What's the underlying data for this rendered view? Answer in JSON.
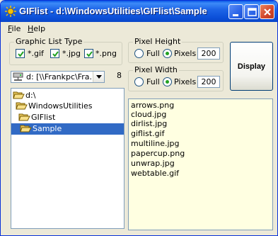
{
  "window": {
    "title": "GIFlist - d:\\WindowsUtilities\\GIFlist\\Sample"
  },
  "menu": [
    {
      "accel": "F",
      "rest": "ile"
    },
    {
      "accel": "H",
      "rest": "elp"
    }
  ],
  "graphic_type": {
    "title": "Graphic List Type",
    "options": [
      {
        "label": "*.gif",
        "checked": true
      },
      {
        "label": "*.jpg",
        "checked": true
      },
      {
        "label": "*.png",
        "checked": true
      }
    ]
  },
  "pixel_height": {
    "title": "Pixel Height",
    "full_label": "Full",
    "pixels_label": "Pixels",
    "selected": "Pixels",
    "value": "200"
  },
  "pixel_width": {
    "title": "Pixel Width",
    "full_label": "Full",
    "pixels_label": "Pixels",
    "selected": "Pixels",
    "value": "200"
  },
  "display_button": "Display",
  "drive": {
    "value": "d: [\\\\Frankpc\\Fra...]",
    "icon": "network-drive-icon"
  },
  "file_count": "8",
  "dir_tree": [
    {
      "label": "d:\\",
      "open": true,
      "selected": false
    },
    {
      "label": "WindowsUtilities",
      "open": true,
      "selected": false
    },
    {
      "label": "GIFlist",
      "open": true,
      "selected": false
    },
    {
      "label": "Sample",
      "open": true,
      "selected": true
    }
  ],
  "files": [
    "arrows.png",
    "cloud.jpg",
    "dirlist.jpg",
    "giflist.gif",
    "multiline.jpg",
    "papercup.png",
    "unwrap.jpg",
    "webtable.gif"
  ],
  "colors": {
    "title_bar": "#0a58e6",
    "selection": "#316ac5",
    "file_list_bg": "#ffffe1"
  }
}
